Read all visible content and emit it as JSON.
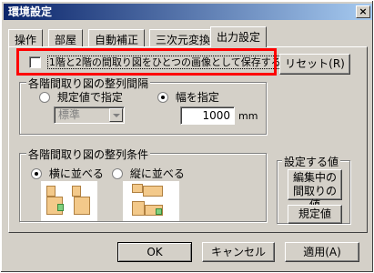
{
  "window": {
    "title": "環境設定",
    "close_glyph": "×"
  },
  "tabs": [
    {
      "label": "操作"
    },
    {
      "label": "部屋"
    },
    {
      "label": "自動補正"
    },
    {
      "label": "三次元変換"
    },
    {
      "label": "出力設定"
    }
  ],
  "save_combined": {
    "label": "1階と2階の間取り図をひとつの画像として保存する",
    "checked": false
  },
  "reset_button": "リセット(R)",
  "spacing_group": {
    "title": "各階間取り図の整列間隔",
    "default_radio": "規定値で指定",
    "width_radio": "幅を指定",
    "combo_value": "標準",
    "width_value": "1000",
    "unit": "mm"
  },
  "align_group": {
    "title": "各階間取り図の整列条件",
    "horizontal_radio": "横に並べる",
    "vertical_radio": "縦に並べる"
  },
  "setting_group": {
    "title": "設定する値",
    "current_button": "編集中の間取りの値",
    "default_button": "規定値"
  },
  "footer": {
    "ok": "OK",
    "cancel": "キャンセル",
    "apply": "適用(A)"
  },
  "colors": {
    "room": "#f3c98a",
    "highlight": "#ff0000",
    "green_room": "#7fd07f"
  }
}
